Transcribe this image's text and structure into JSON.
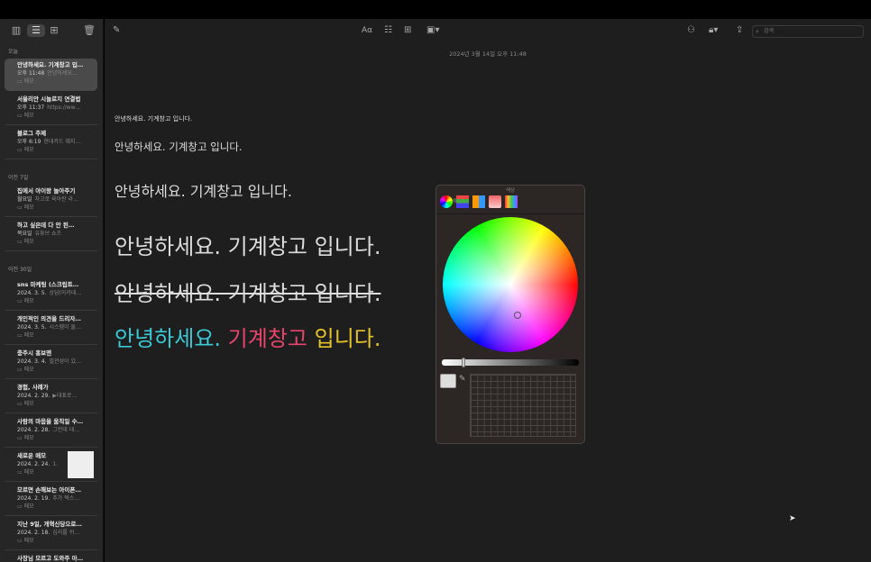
{
  "sidebar": {
    "sections": {
      "today": "오늘",
      "prev7": "이전 7일",
      "prev30": "이전 30일"
    },
    "notes": [
      {
        "title": "안녕하세요. 기계창고 입…",
        "date": "오후 11:48",
        "preview": "안녕하세요…",
        "folder": "메모"
      },
      {
        "title": "서울리안 시놀로지 연결법",
        "date": "오후 11:37",
        "preview": "https://ww…",
        "folder": "메모"
      },
      {
        "title": "블로그 주제",
        "date": "오후 6:19",
        "preview": "현대카드 혜지…",
        "folder": "메모"
      },
      {
        "title": "집에서 아이랑 놀아주기",
        "date": "월요일",
        "preview": "자고로 육아란 라…",
        "folder": "메모"
      },
      {
        "title": "하고 싶은데 다 안 된…",
        "date": "목요일",
        "preview": "유튜브 쇼츠",
        "folder": "메모"
      },
      {
        "title": "sns 마케팅 (스크립트…",
        "date": "2024. 3. 5.",
        "preview": "상담(아카데…",
        "folder": "메모"
      },
      {
        "title": "개인적인 의견을 드리자…",
        "date": "2024. 3. 5.",
        "preview": "시스템이 돌…",
        "folder": "메모"
      },
      {
        "title": "충주시 홍보맨",
        "date": "2024. 3. 4.",
        "preview": "필관성이 있…",
        "folder": "메모"
      },
      {
        "title": "경험, 사례가",
        "date": "2024. 2. 29.",
        "preview": "▶대표로…",
        "folder": "메모"
      },
      {
        "title": "사람의 마음을 움직일 수…",
        "date": "2024. 2. 28.",
        "preview": "그런데 대…",
        "folder": "메모"
      },
      {
        "title": "새로운 메모",
        "date": "2024. 2. 24.",
        "preview": "1.",
        "folder": "메모"
      },
      {
        "title": "모르면 손해보는 아이폰…",
        "date": "2024. 2. 19.",
        "preview": "추가 텍스…",
        "folder": "메모"
      },
      {
        "title": "지난 9일, 개혁신당으로…",
        "date": "2024. 2. 18.",
        "preview": "심리를 쉬…",
        "folder": "메모"
      },
      {
        "title": "사장님 모르고 도와주 아…",
        "date": "",
        "preview": "",
        "folder": ""
      }
    ]
  },
  "toolbar": {
    "format_label": "Aα",
    "search_placeholder": "검색"
  },
  "note": {
    "date": "2024년 3월 14일 오후 11:48",
    "lines": [
      "안녕하세요. 기계창고 입니다.",
      "안녕하세요. 기계창고 입니다.",
      "안녕하세요. 기계창고 입니다.",
      "안녕하세요. 기계창고 입니다.",
      "안녕하세요. 기계창고 입니다."
    ],
    "colored": {
      "part1": "안녕하세요.",
      "part2": "기계창고",
      "part3": "입니다."
    }
  },
  "color_panel": {
    "title": "색상",
    "selected_color": "#dddddd",
    "brightness": 0.15
  },
  "colors": {
    "cyan": "#3cc9d6",
    "pink": "#e8456e",
    "yellow": "#e5c42a"
  }
}
